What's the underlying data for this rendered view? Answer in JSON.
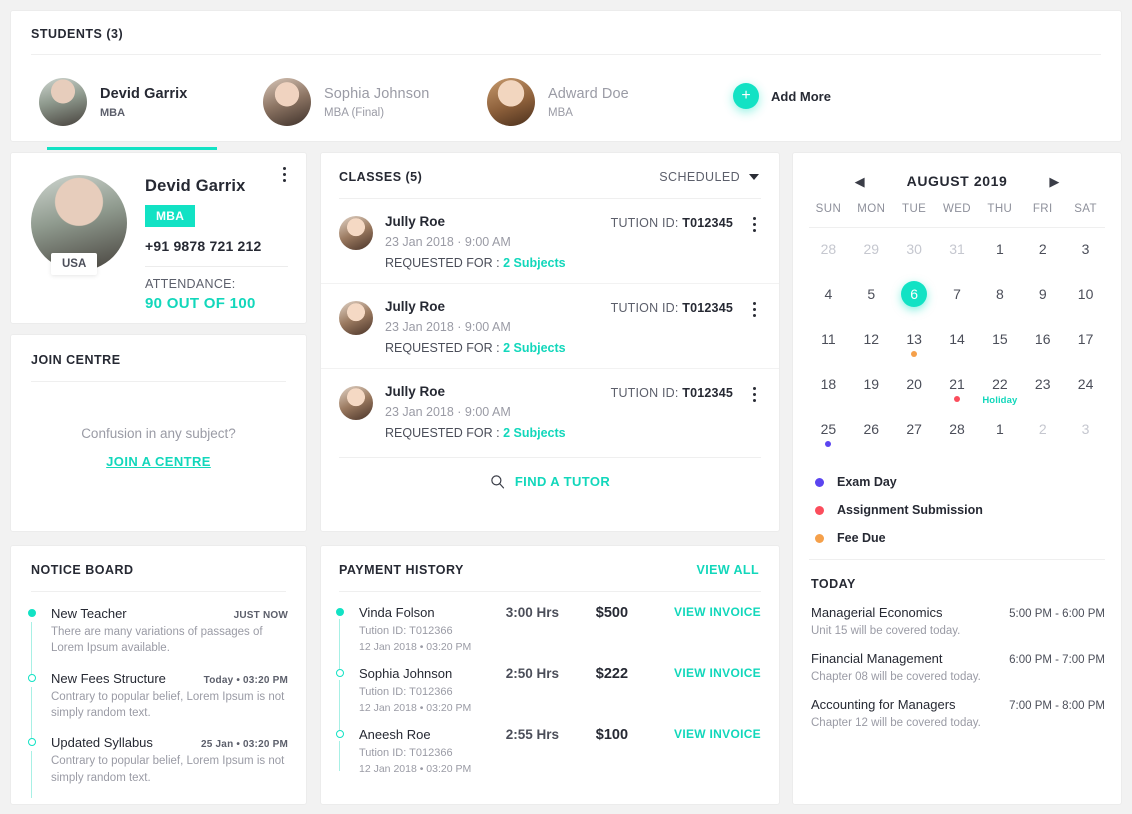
{
  "students": {
    "title": "STUDENTS (3)",
    "items": [
      {
        "name": "Devid Garrix",
        "degree": "MBA",
        "avatar": "av-a",
        "active": true
      },
      {
        "name": "Sophia Johnson",
        "degree": "MBA (Final)",
        "avatar": "av-b",
        "active": false
      },
      {
        "name": "Adward Doe",
        "degree": "MBA",
        "avatar": "av-c",
        "active": false
      }
    ],
    "add_more_label": "Add More",
    "add_more_icon": "plus-icon"
  },
  "profile": {
    "name": "Devid Garrix",
    "badge": "MBA",
    "phone": "+91 9878 721 212",
    "country": "USA",
    "attendance_label": "ATTENDANCE:",
    "attendance_value": "90 OUT OF 100",
    "menu_icon": "kebab-menu-icon",
    "avatar": "av-a"
  },
  "join_centre": {
    "title": "JOIN CENTRE",
    "question": "Confusion in any subject?",
    "link": "JOIN A CENTRE"
  },
  "notice_board": {
    "title": "NOTICE BOARD",
    "items": [
      {
        "title": "New Teacher",
        "time": "JUST NOW",
        "desc": "There are many variations of passages of Lorem Ipsum available.",
        "filled": true
      },
      {
        "title": "New Fees Structure",
        "time": "Today • 03:20 PM",
        "desc": "Contrary to popular belief, Lorem Ipsum is not simply random text.",
        "filled": false
      },
      {
        "title": "Updated Syllabus",
        "time": "25 Jan • 03:20 PM",
        "desc": "Contrary to popular belief, Lorem Ipsum is not simply random text.",
        "filled": false
      }
    ]
  },
  "classes": {
    "title": "CLASSES (5)",
    "filter_label": "SCHEDULED",
    "filter_icon": "chevron-down-icon",
    "items": [
      {
        "name": "Jully Roe",
        "when": "23 Jan 2018  ·  9:00 AM",
        "requested_label": "REQUESTED FOR : ",
        "requested_value": "2 Subjects",
        "tuition_label": "TUTION ID: ",
        "tuition_id": "T012345",
        "avatar": "av-d"
      },
      {
        "name": "Jully Roe",
        "when": "23 Jan 2018  ·  9:00 AM",
        "requested_label": "REQUESTED FOR : ",
        "requested_value": "2 Subjects",
        "tuition_label": "TUTION ID: ",
        "tuition_id": "T012345",
        "avatar": "av-d"
      },
      {
        "name": "Jully Roe",
        "when": "23 Jan 2018  ·  9:00 AM",
        "requested_label": "REQUESTED FOR : ",
        "requested_value": "2 Subjects",
        "tuition_label": "TUTION ID: ",
        "tuition_id": "T012345",
        "avatar": "av-d"
      }
    ],
    "find_tutor_label": "FIND A TUTOR",
    "find_tutor_icon": "search-icon"
  },
  "payment_history": {
    "title": "PAYMENT HISTORY",
    "view_all": "VIEW ALL",
    "items": [
      {
        "name": "Vinda Folson",
        "tuition": "Tution ID: T012366",
        "date": "12 Jan 2018 • 03:20 PM",
        "hours": "3:00 Hrs",
        "amount": "$500",
        "invoice": "VIEW INVOICE",
        "filled": true
      },
      {
        "name": "Sophia Johnson",
        "tuition": "Tution ID: T012366",
        "date": "12 Jan 2018 • 03:20 PM",
        "hours": "2:50 Hrs",
        "amount": "$222",
        "invoice": "VIEW INVOICE",
        "filled": false
      },
      {
        "name": "Aneesh Roe",
        "tuition": "Tution ID: T012366",
        "date": "12 Jan 2018 • 03:20 PM",
        "hours": "2:55 Hrs",
        "amount": "$100",
        "invoice": "VIEW INVOICE",
        "filled": false
      }
    ]
  },
  "calendar": {
    "month": "AUGUST 2019",
    "prev_icon": "arrow-left-icon",
    "next_icon": "arrow-right-icon",
    "dows": [
      "SUN",
      "MON",
      "TUE",
      "WED",
      "THU",
      "FRI",
      "SAT"
    ],
    "days": [
      {
        "n": "28",
        "muted": true
      },
      {
        "n": "29",
        "muted": true
      },
      {
        "n": "30",
        "muted": true
      },
      {
        "n": "31",
        "muted": true
      },
      {
        "n": "1"
      },
      {
        "n": "2"
      },
      {
        "n": "3"
      },
      {
        "n": "4"
      },
      {
        "n": "5"
      },
      {
        "n": "6",
        "today": true
      },
      {
        "n": "7"
      },
      {
        "n": "8"
      },
      {
        "n": "9"
      },
      {
        "n": "10"
      },
      {
        "n": "11"
      },
      {
        "n": "12"
      },
      {
        "n": "13",
        "mark": "#f5a04a"
      },
      {
        "n": "14"
      },
      {
        "n": "15"
      },
      {
        "n": "16"
      },
      {
        "n": "17"
      },
      {
        "n": "18"
      },
      {
        "n": "19"
      },
      {
        "n": "20"
      },
      {
        "n": "21",
        "mark": "#fb4d5c"
      },
      {
        "n": "22",
        "holiday": "Holiday"
      },
      {
        "n": "23"
      },
      {
        "n": "24"
      },
      {
        "n": "25",
        "mark": "#5b45f0"
      },
      {
        "n": "26"
      },
      {
        "n": "27"
      },
      {
        "n": "28"
      },
      {
        "n": "1"
      },
      {
        "n": "2",
        "muted": true
      },
      {
        "n": "3",
        "muted": true
      }
    ],
    "legend": [
      {
        "label": "Exam Day",
        "color": "#5b45f0"
      },
      {
        "label": "Assignment Submission",
        "color": "#fb4d5c"
      },
      {
        "label": "Fee Due",
        "color": "#f5a04a"
      }
    ]
  },
  "today": {
    "title": "TODAY",
    "events": [
      {
        "name": "Managerial Economics",
        "time": "5:00 PM - 6:00 PM",
        "note": "Unit 15 will be covered today."
      },
      {
        "name": "Financial Management",
        "time": "6:00 PM - 7:00 PM",
        "note": "Chapter 08 will be covered today."
      },
      {
        "name": "Accounting for Managers",
        "time": "7:00 PM - 8:00 PM",
        "note": "Chapter 12 will be covered today."
      }
    ]
  },
  "colors": {
    "accent": "#12e2c4",
    "accent_text": "#12d7bb",
    "text": "#262933",
    "muted": "#9a9ba5"
  }
}
